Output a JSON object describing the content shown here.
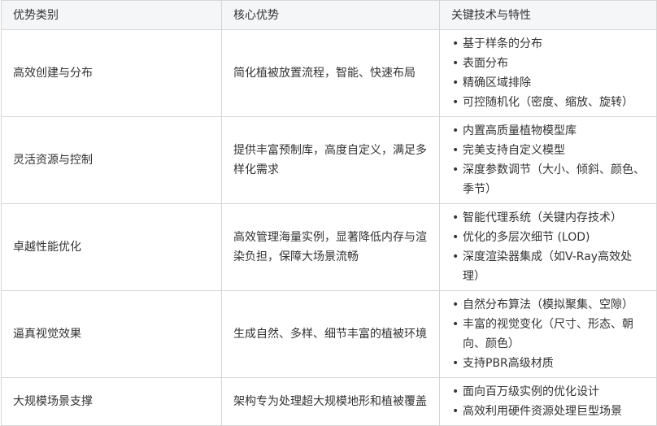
{
  "headers": [
    "优势类别",
    "核心优势",
    "关键技术与特性"
  ],
  "rows": [
    {
      "category": "高效创建与分布",
      "advantage": "简化植被放置流程，智能、快速布局",
      "features": [
        "基于样条的分布",
        "表面分布",
        "精确区域排除",
        "可控随机化（密度、缩放、旋转）"
      ]
    },
    {
      "category": "灵活资源与控制",
      "advantage": "提供丰富预制库，高度自定义，满足多样化需求",
      "features": [
        "内置高质量植物模型库",
        "完美支持自定义模型",
        "深度参数调节（大小、倾斜、颜色、季节）"
      ]
    },
    {
      "category": "卓越性能优化",
      "advantage": "高效管理海量实例，显著降低内存与渲染负担，保障大场景流畅",
      "features": [
        "智能代理系统（关键内存技术）",
        "优化的多层次细节 (LOD)",
        "深度渲染器集成（如V-Ray高效处理）"
      ]
    },
    {
      "category": "逼真视觉效果",
      "advantage": "生成自然、多样、细节丰富的植被环境",
      "features": [
        "自然分布算法（模拟聚集、空隙）",
        "丰富的视觉变化（尺寸、形态、朝向、颜色）",
        "支持PBR高级材质"
      ]
    },
    {
      "category": "大规模场景支撑",
      "advantage": "架构专为处理超大规模地形和植被覆盖",
      "features": [
        "面向百万级实例的优化设计",
        "高效利用硬件资源处理巨型场景"
      ]
    }
  ]
}
